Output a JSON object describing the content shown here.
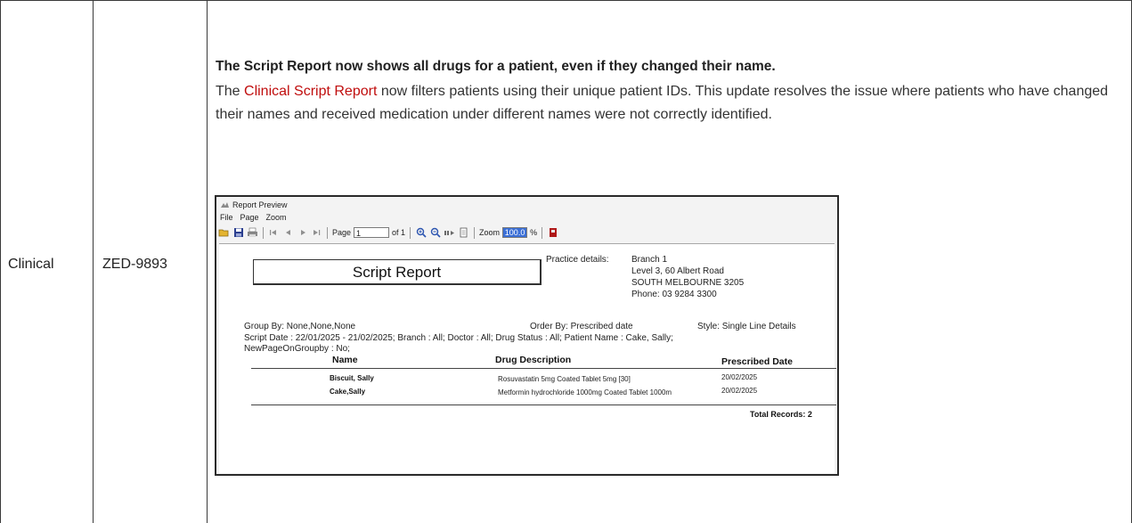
{
  "row": {
    "category": "Clinical",
    "ticket": "ZED-9893",
    "heading": "The Script Report now shows all drugs for a patient, even if they changed their name.",
    "para_prefix": "The ",
    "para_link": "Clinical Script Report",
    "para_rest": " now filters patients using their unique patient IDs. This update resolves the issue where patients who have changed their names and received medication under different names were not correctly identified."
  },
  "preview": {
    "window_title": "Report Preview",
    "menu": [
      "File",
      "Page",
      "Zoom"
    ],
    "toolbar": {
      "page_label": "Page",
      "page_value": "1",
      "of_label": "of 1",
      "zoom_label": "Zoom",
      "zoom_value": "100.0",
      "percent": "%"
    },
    "report": {
      "title": "Script Report",
      "practice_label": "Practice details:",
      "practice_lines": [
        "Branch 1",
        "Level 3, 60 Albert Road",
        "SOUTH  MELBOURNE  3205",
        "Phone: 03 9284 3300"
      ],
      "group_by": "Group By: None,None,None",
      "order_by": "Order By: Prescribed date",
      "style": "Style: Single Line Details",
      "filter_line1": "Script Date : 22/01/2025 - 21/02/2025; Branch : All; Doctor : All; Drug Status : All; Patient Name : Cake, Sally;",
      "filter_line2": "NewPageOnGroupby : No;",
      "columns": [
        "Name",
        "Drug Description",
        "Prescribed Date"
      ],
      "rows": [
        {
          "name": "Biscuit, Sally",
          "drug": "Rosuvastatin 5mg Coated Tablet 5mg [30]",
          "date": "20/02/2025"
        },
        {
          "name": "Cake,Sally",
          "drug": "Metformin hydrochloride 1000mg Coated Tablet 1000m",
          "date": "20/02/2025"
        }
      ],
      "total": "Total Records: 2"
    }
  },
  "colors": {
    "link": "#c00d0d",
    "border": "#3a3a3a",
    "zoom_highlight": "#3b6fd6"
  }
}
